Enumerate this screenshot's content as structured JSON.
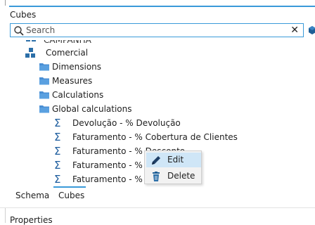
{
  "panel": {
    "title": "Cubes"
  },
  "search": {
    "placeholder": "Search",
    "value": "",
    "clear_glyph": "✕"
  },
  "tree": {
    "partial_node_label": "CAMPANHA",
    "cube_label": "Comercial",
    "folders": [
      "Dimensions",
      "Measures",
      "Calculations",
      "Global calculations"
    ],
    "calculations": [
      "Devolução - % Devolução",
      "Faturamento - % Cobertura de Clientes",
      "Faturamento - % Desconto",
      "Faturamento - % Lu",
      "Faturamento - % Pe"
    ],
    "sigma_glyph": "Σ"
  },
  "context_menu": {
    "edit_label": "Edit",
    "delete_label": "Delete"
  },
  "tabs": {
    "schema": "Schema",
    "cubes": "Cubes",
    "active": "Cubes"
  },
  "footer": {
    "properties_label": "Properties"
  },
  "colors": {
    "accent": "#3a9ad9",
    "folder": "#4a8fd4",
    "cube": "#2c6fa8",
    "menu_hover": "#cfe6f7"
  }
}
